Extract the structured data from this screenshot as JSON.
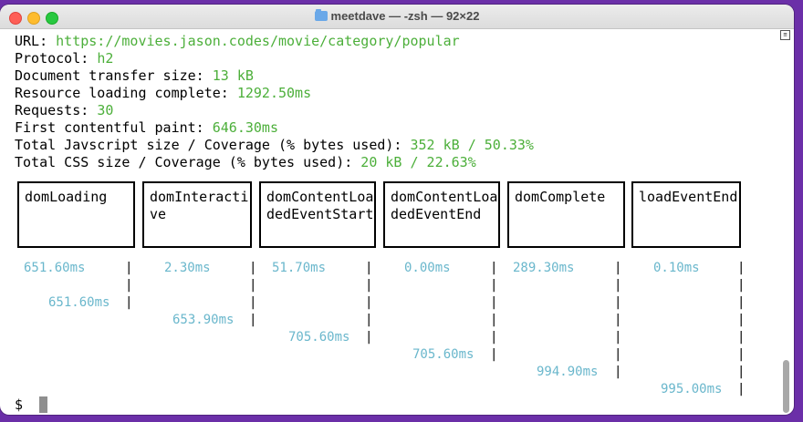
{
  "window": {
    "title": "meetdave — -zsh — 92×22"
  },
  "colors": {
    "value_green": "#4caf3a",
    "timing_cyan": "#6ab7cc",
    "background_purple": "#6b2fa8"
  },
  "report": {
    "url_label": "URL: ",
    "url_value": "https://movies.jason.codes/movie/category/popular",
    "protocol_label": "Protocol: ",
    "protocol_value": "h2",
    "transfer_label": "Document transfer size: ",
    "transfer_value": "13 kB",
    "resource_label": "Resource loading complete: ",
    "resource_value": "1292.50ms",
    "requests_label": "Requests: ",
    "requests_value": "30",
    "fcp_label": "First contentful paint: ",
    "fcp_value": "646.30ms",
    "js_label": "Total Javscript size / Coverage (% bytes used): ",
    "js_value": "352 kB / 50.33%",
    "css_label": "Total CSS size / Coverage (% bytes used): ",
    "css_value": "20 kB / 22.63%"
  },
  "timeline": {
    "events": [
      {
        "name": "domLoading",
        "duration": "651.60ms",
        "cumulative": "651.60ms"
      },
      {
        "name": "domInteractive",
        "duration": "2.30ms",
        "cumulative": "653.90ms"
      },
      {
        "name": "domContentLoadedEventStart",
        "duration": "51.70ms",
        "cumulative": "705.60ms"
      },
      {
        "name": "domContentLoadedEventEnd",
        "duration": "0.00ms",
        "cumulative": "705.60ms"
      },
      {
        "name": "domComplete",
        "duration": "289.30ms",
        "cumulative": "994.90ms"
      },
      {
        "name": "loadEventEnd",
        "duration": "0.10ms",
        "cumulative": "995.00ms"
      }
    ]
  },
  "prompt": {
    "symbol": "$"
  }
}
